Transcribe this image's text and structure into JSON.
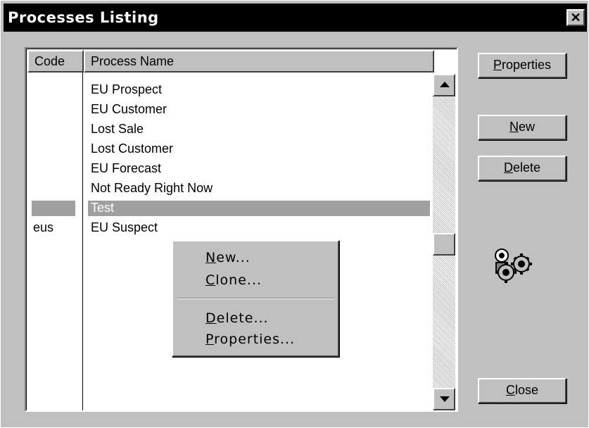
{
  "window": {
    "title": "Processes Listing",
    "close_glyph": "✕"
  },
  "table": {
    "headers": {
      "code": "Code",
      "name": "Process Name"
    },
    "rows": [
      {
        "code": "",
        "name": "EU Prospect"
      },
      {
        "code": "",
        "name": "EU Customer"
      },
      {
        "code": "",
        "name": "Lost Sale"
      },
      {
        "code": "",
        "name": "Lost Customer"
      },
      {
        "code": "",
        "name": "EU Forecast"
      },
      {
        "code": "",
        "name": "Not Ready Right Now"
      },
      {
        "code": "",
        "name": "Test",
        "selected": true
      },
      {
        "code": "eus",
        "name": "EU Suspect"
      }
    ]
  },
  "buttons": {
    "properties": {
      "accel": "P",
      "rest": "roperties"
    },
    "new": {
      "accel": "N",
      "rest": "ew"
    },
    "delete": {
      "accel": "D",
      "rest": "elete"
    },
    "close": {
      "accel": "C",
      "rest": "lose"
    }
  },
  "context_menu": {
    "new": {
      "accel": "N",
      "rest": "ew..."
    },
    "clone": {
      "accel": "C",
      "rest": "lone..."
    },
    "delete": {
      "accel": "D",
      "rest": "elete..."
    },
    "properties": {
      "accel": "P",
      "rest": "roperties..."
    }
  },
  "icons": {
    "gears": "gears-icon"
  }
}
